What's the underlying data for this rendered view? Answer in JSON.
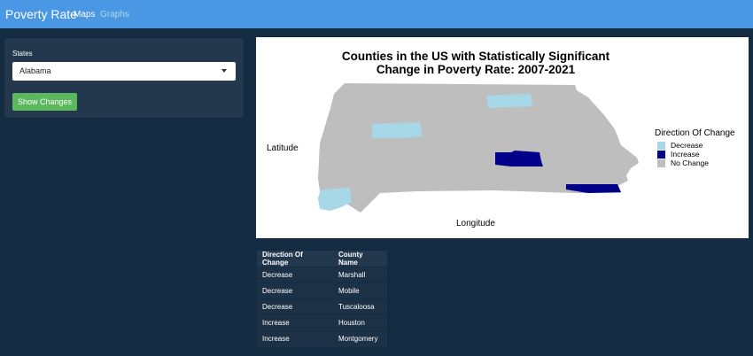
{
  "navbar": {
    "brand": "Poverty Rate",
    "tabs": [
      {
        "label": "Maps",
        "active": true
      },
      {
        "label": "Graphs",
        "active": false
      }
    ]
  },
  "sidebar": {
    "states_label": "States",
    "selected_state": "Alabama",
    "button_label": "Show Changes"
  },
  "plot": {
    "title_line1": "Counties in the US with Statistically Significant",
    "title_line2": "Change in Poverty Rate: 2007-2021",
    "xlabel": "Longitude",
    "ylabel": "Latitude",
    "legend_title": "Direction Of Change",
    "legend": [
      {
        "label": "Decrease",
        "color": "#a6d8e7"
      },
      {
        "label": "Increase",
        "color": "#00008b"
      },
      {
        "label": "No Change",
        "color": "#bebebe"
      }
    ]
  },
  "table": {
    "headers": [
      "Direction Of Change",
      "County Name"
    ],
    "rows": [
      [
        "Decrease",
        "Marshall"
      ],
      [
        "Decrease",
        "Mobile"
      ],
      [
        "Decrease",
        "Tuscaloosa"
      ],
      [
        "Increase",
        "Houston"
      ],
      [
        "Increase",
        "Montgomery"
      ]
    ]
  },
  "colors": {
    "navbar": "#4a98e3",
    "background": "#142c42",
    "panel": "#23384d",
    "button": "#5cb85c"
  }
}
